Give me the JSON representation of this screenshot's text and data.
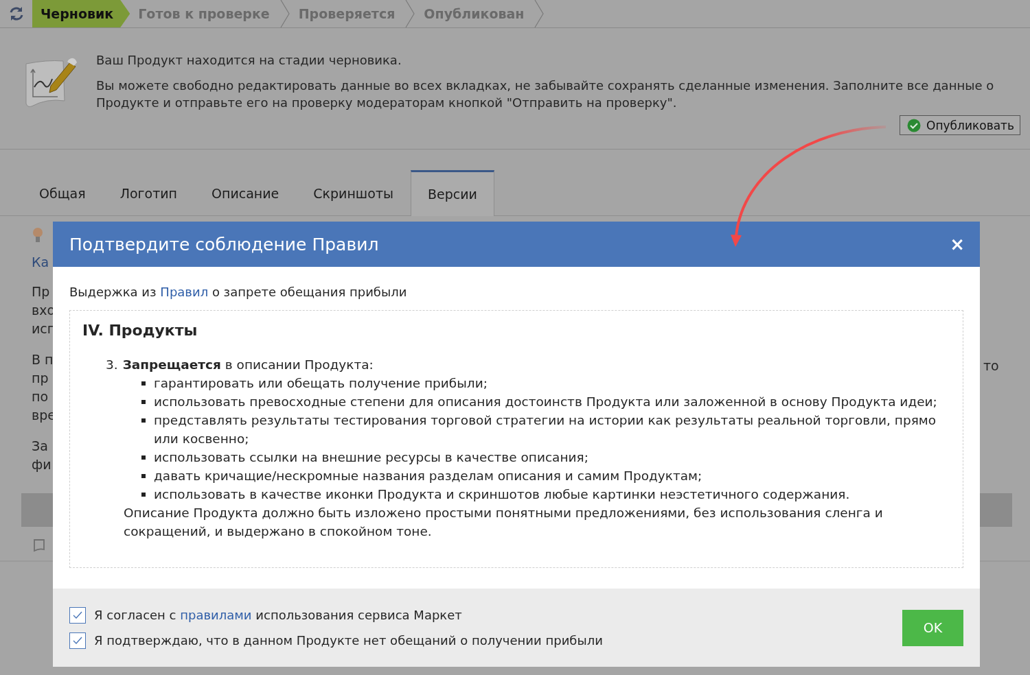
{
  "status_steps": [
    {
      "label": "Черновик",
      "selected": true
    },
    {
      "label": "Готов к проверке",
      "selected": false
    },
    {
      "label": "Проверяется",
      "selected": false
    },
    {
      "label": "Опубликован",
      "selected": false
    }
  ],
  "notice": {
    "title": "Ваш Продукт находится на стадии черновика.",
    "text": "Вы можете свободно редактировать данные во всех вкладках, не забывайте сохранять сделанные изменения. Заполните все данные о Продукте и отправьте его на проверку модераторам кнопкой \"Отправить на проверку\"."
  },
  "publish_button": "Опубликовать",
  "tabs": [
    {
      "label": "Общая",
      "selected": false
    },
    {
      "label": "Логотип",
      "selected": false
    },
    {
      "label": "Описание",
      "selected": false
    },
    {
      "label": "Скриншоты",
      "selected": false
    },
    {
      "label": "Версии",
      "selected": true
    }
  ],
  "background": {
    "link": "Ка",
    "paragraphs": [
      [
        "Пр",
        "вхо",
        "исп"
      ],
      [
        "В п",
        "пр",
        "по",
        "вре"
      ],
      [
        "За",
        "фи"
      ]
    ],
    "right_fragment": "то"
  },
  "dialog": {
    "title": "Подтвердите соблюдение Правил",
    "close": "×",
    "intro": {
      "before": "Выдержка из ",
      "link": "Правил",
      "after": " о запрете обещания прибыли"
    },
    "section_title": "IV. Продукты",
    "item_number": "3.",
    "item_text": "**Запрещается** в описании Продукта:",
    "bullets": [
      "гарантировать или обещать получение прибыли;",
      "использовать превосходные степени для описания достоинств Продукта или заложенной в основу Продукта идеи;",
      "представлять результаты тестирования торговой стратегии на истории как результаты реальной торговли, прямо или косвенно;",
      "использовать ссылки на внешние ресурсы в качестве описания;",
      "давать кричащие/нескромные названия разделам описания и самим Продуктам;",
      "использовать в качестве иконки Продукта и скриншотов любые картинки неэстетичного содержания."
    ],
    "closing": "Описание Продукта должно быть изложено простыми понятными предложениями, без использования сленга и сокращений, и выдержано в спокойном тоне.",
    "checkboxes": [
      {
        "before": "Я согласен с ",
        "link": "правилами",
        "after": " использования сервиса Маркет",
        "checked": true
      },
      {
        "before": "Я подтверждаю, что в данном Продукте нет обещаний о получении прибыли",
        "checked": true
      }
    ],
    "ok_button": "OK"
  }
}
